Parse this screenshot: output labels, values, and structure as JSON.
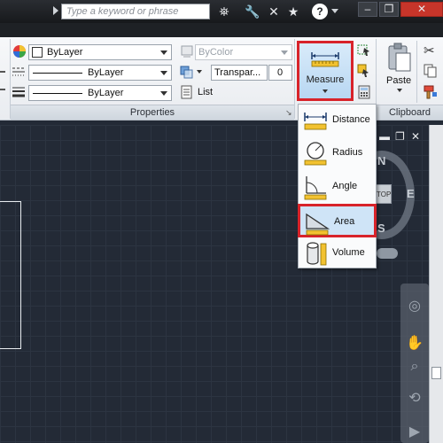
{
  "titlebar": {
    "search_placeholder": "Type a keyword or phrase",
    "help_label": "?"
  },
  "properties_panel": {
    "label": "Properties",
    "color_value": "ByLayer",
    "linetype_value": "ByLayer",
    "lineweight_value": "ByLayer",
    "plotstyle_value": "ByColor",
    "transparency_label": "Transpar...",
    "transparency_value": "0",
    "list_label": "List"
  },
  "measure": {
    "label": "Measure",
    "items": [
      {
        "label": "Distance",
        "icon": "distance-icon"
      },
      {
        "label": "Radius",
        "icon": "radius-icon"
      },
      {
        "label": "Angle",
        "icon": "angle-icon"
      },
      {
        "label": "Area",
        "icon": "area-icon"
      },
      {
        "label": "Volume",
        "icon": "volume-icon"
      }
    ]
  },
  "clipboard_panel": {
    "label": "Clipboard",
    "paste_label": "Paste"
  },
  "viewcube": {
    "north": "N",
    "east": "E",
    "south": "S",
    "top_face": "TOP"
  },
  "colors": {
    "highlight_red": "#d8232a",
    "canvas_bg": "#232a36",
    "measure_btn_bg": "#c6e0f6"
  }
}
